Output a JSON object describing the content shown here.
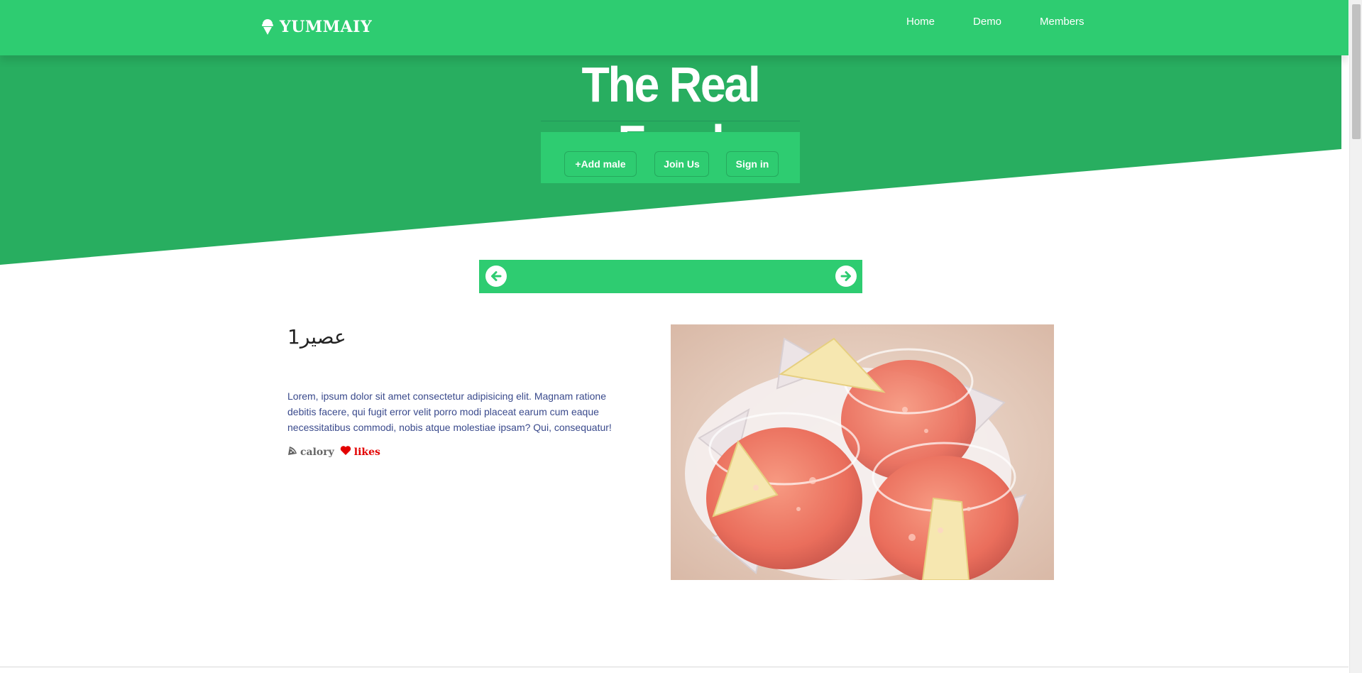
{
  "brand": {
    "name": "YUMMAIY",
    "icon": "ice-cream-icon"
  },
  "nav": {
    "items": [
      "Home",
      "Demo",
      "Members"
    ]
  },
  "hero": {
    "title": "The Real Food",
    "buttons": {
      "add_meal": "+Add male",
      "join": "Join Us",
      "sign_in": "Sign in"
    }
  },
  "slider": {
    "prev_icon": "arrow-left-circle-icon",
    "next_icon": "arrow-right-circle-icon"
  },
  "item": {
    "title": "عصير1",
    "description": "Lorem, ipsum dolor sit amet consectetur adipisicing elit. Magnam ratione debitis facere, qui fugit error velit porro modi placeat earum cum eaque necessitatibus commodi, nobis atque molestiae ipsam? Qui, consequatur!",
    "calory_label": "calory",
    "calory_icon": "pizza-slice-icon",
    "likes_label": "likes",
    "likes_icon": "heart-icon",
    "image": "juice-glasses-photo"
  },
  "colors": {
    "primary": "#2ecc71",
    "primary_dark": "#28ae60",
    "text_blue": "#3a4a8c",
    "likes_red": "#e30000"
  }
}
